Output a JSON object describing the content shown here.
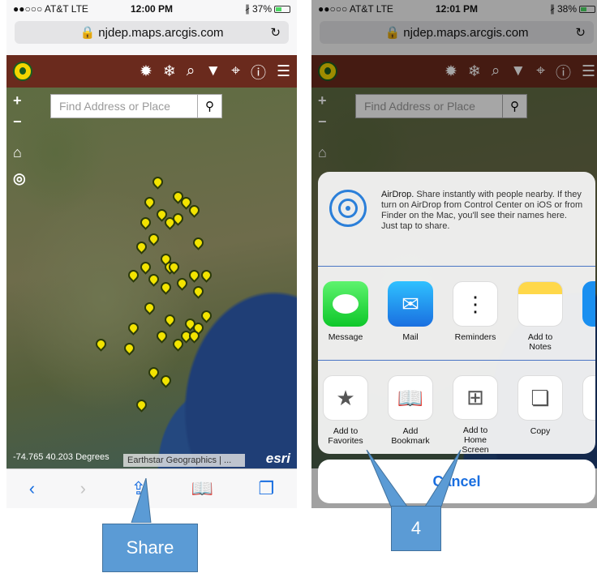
{
  "left": {
    "status": {
      "carrier": "●●○○○ AT&T  LTE",
      "time": "12:00 PM",
      "battery": "37%"
    },
    "url": "🔒 njdep.maps.arcgis.com",
    "search_placeholder": "Find Address or Place",
    "coords": "-74.765 40.203 Degrees",
    "attribution": "Earthstar Geographics | ...",
    "esri": "esri"
  },
  "right": {
    "status": {
      "carrier": "●●○○○ AT&T  LTE",
      "time": "12:01 PM",
      "battery": "38%"
    },
    "url": "🔒 njdep.maps.arcgis.com",
    "search_placeholder": "Find Address or Place",
    "airdrop_title": "AirDrop.",
    "airdrop_text": " Share instantly with people nearby. If they turn on AirDrop from Control Center on iOS or from Finder on the Mac, you'll see their names here. Just tap to share.",
    "share_apps": [
      "Message",
      "Mail",
      "Reminders",
      "Add to Notes"
    ],
    "actions": [
      "Add to Favorites",
      "Add Bookmark",
      "Add to Home Screen",
      "Copy"
    ],
    "cancel": "Cancel"
  },
  "callouts": {
    "share": "Share",
    "step": "4"
  }
}
